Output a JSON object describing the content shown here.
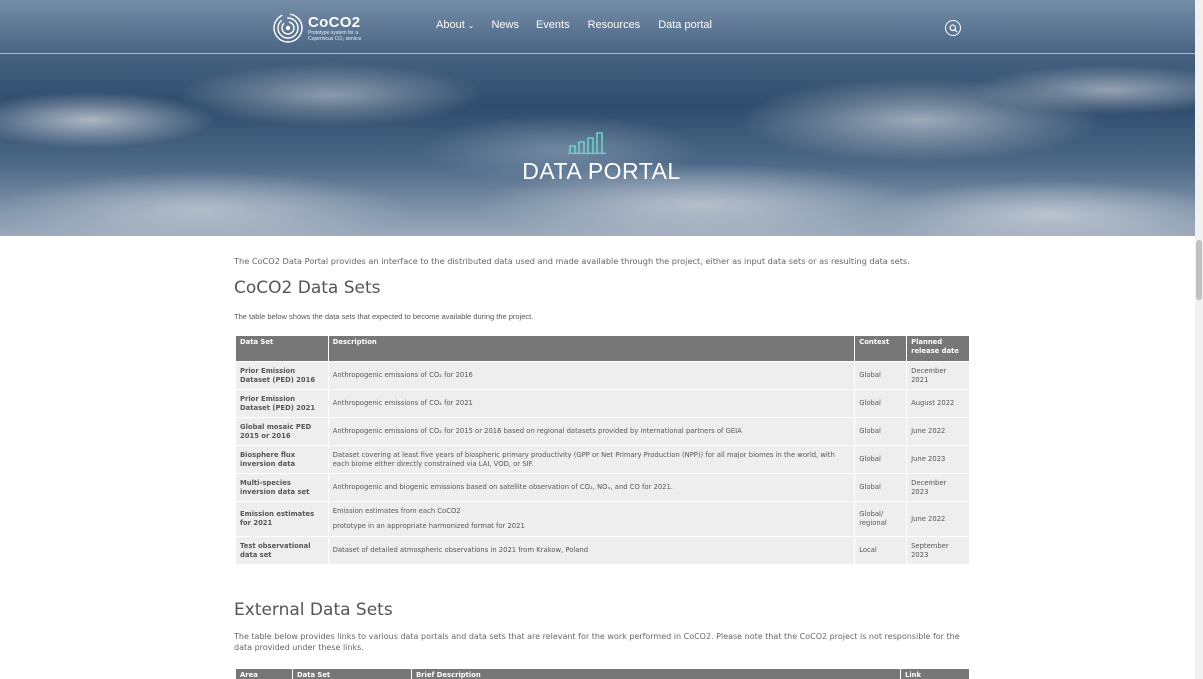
{
  "header": {
    "logo_title": "CoCO2",
    "logo_subtitle": "Prototype system for a Copernicus CO₂ service",
    "nav": [
      {
        "label": "About",
        "has_dropdown": true
      },
      {
        "label": "News"
      },
      {
        "label": "Events"
      },
      {
        "label": "Resources"
      },
      {
        "label": "Data portal"
      }
    ],
    "search_icon": "search-icon",
    "chevron_icon": "chevron-down-icon"
  },
  "hero": {
    "icon": "bar-chart-icon",
    "title": "DATA PORTAL"
  },
  "main": {
    "intro": "The CoCO2 Data Portal provides an interface to the distributed data used and made available through the project, either as input data sets or as resulting data sets.",
    "coco2": {
      "heading": "CoCO2 Data Sets",
      "subtitle": "The table below shows the data sets that expected to become available during the project.",
      "columns": [
        "Data Set",
        "Description",
        "Context",
        "Planned release date"
      ],
      "rows": [
        {
          "name": "Prior Emission Dataset (PED) 2016",
          "description": "Anthropogenic emissions of CO₂ for 2016",
          "context": "Global",
          "date": "December 2021"
        },
        {
          "name": "Prior Emission Dataset (PED) 2021",
          "description": "Anthropogenic emissions of CO₂ for 2021",
          "context": "Global",
          "date": "August 2022"
        },
        {
          "name": "Global mosaic PED 2015 or 2016",
          "description": "Anthropogenic emissions of CO₂ for 2015 or 2016 based on regional datasets provided by international partners of GEIA",
          "context": "Global",
          "date": "June 2022"
        },
        {
          "name": "Biosphere flux inversion data",
          "description": "Dataset covering at least five years of biospheric primary productivity (GPP or Net Primary Production (NPP)) for all major biomes in the world, with each biome either directly constrained via LAI, VOD, or SIF.",
          "context": "Global",
          "date": "June 2023"
        },
        {
          "name": "Multi-species inversion data set",
          "description": "Anthropogenic and biogenic emissions based on satellite observation of CO₂, NOₓ, and CO for 2021.",
          "context": "Global",
          "date": "December 2023"
        },
        {
          "name": "Emission estimates for 2021",
          "description": "Emission estimates from each CoCO2",
          "description2": "prototype in an appropriate harmonized format for 2021",
          "context": "Global/ regional",
          "date": "June 2022"
        },
        {
          "name": "Test observational data set",
          "description": "Dataset of detailed atmospheric observations in 2021 from Krakow, Poland",
          "context": "Local",
          "date": "September 2023"
        }
      ]
    },
    "external": {
      "heading": "External Data Sets",
      "subtitle": "The table below provides links to various data portals and data sets that are relevant for the work performed in CoCO2. Please note that the CoCO2 project is not responsible for the data provided under these links.",
      "columns": [
        "Area",
        "Data Set",
        "Brief Description",
        "Link"
      ]
    }
  }
}
